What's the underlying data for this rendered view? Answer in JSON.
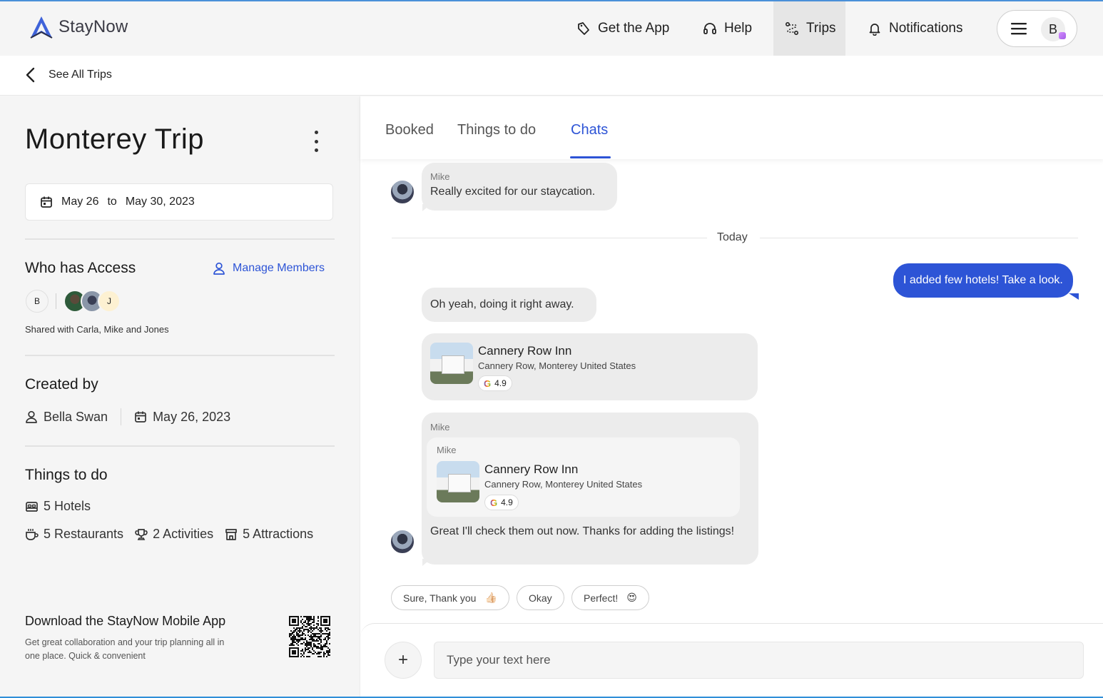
{
  "app": {
    "brand": "StayNow"
  },
  "nav": {
    "get_app": "Get the App",
    "help": "Help",
    "trips": "Trips",
    "notifications": "Notifications",
    "user_initial": "B"
  },
  "back": {
    "label": "See All Trips"
  },
  "trip": {
    "title": "Monterey Trip",
    "date_from": "May 26",
    "date_to_word": "to",
    "date_to": "May 30, 2023"
  },
  "access": {
    "heading": "Who has Access",
    "manage_label": "Manage Members",
    "owner_initial": "B",
    "member_initial_j": "J",
    "shared_text": "Shared with Carla, Mike and Jones"
  },
  "created": {
    "heading": "Created by",
    "name": "Bella Swan",
    "date": "May 26, 2023"
  },
  "things": {
    "heading": "Things to do",
    "hotels": "5 Hotels",
    "restaurants": "5 Restaurants",
    "activities": "2 Activities",
    "attractions": "5 Attractions"
  },
  "download": {
    "title": "Download the StayNow Mobile App",
    "text": "Get great collaboration and your trip planning all in one place. Quick & convenient"
  },
  "tabs": {
    "booked": "Booked",
    "things": "Things to do",
    "chats": "Chats",
    "active": "Chats"
  },
  "chat": {
    "msg1": {
      "sender": "Mike",
      "text": "Really excited for our staycation."
    },
    "divider": "Today",
    "mine": "I added few hotels! Take a look.",
    "msg2": {
      "text": "Oh yeah, doing it right away."
    },
    "card1": {
      "title": "Cannery Row Inn",
      "address": "Cannery Row, Monterey United States",
      "rating": "4.9"
    },
    "msg3": {
      "sender": "Mike",
      "quoted_sender": "Mike",
      "card": {
        "title": "Cannery Row Inn",
        "address": "Cannery Row, Monterey United States",
        "rating": "4.9"
      },
      "text": "Great I'll check them out now. Thanks for adding the listings!"
    }
  },
  "quick_replies": [
    {
      "label": "Sure, Thank you",
      "emoji": "👍🏻"
    },
    {
      "label": "Okay",
      "emoji": ""
    },
    {
      "label": "Perfect!",
      "emoji": "😍"
    }
  ],
  "composer": {
    "placeholder": "Type your text here",
    "value": ""
  },
  "colors": {
    "accent": "#2d54d6",
    "bubble": "#ececec",
    "panel": "#f5f5f5"
  }
}
